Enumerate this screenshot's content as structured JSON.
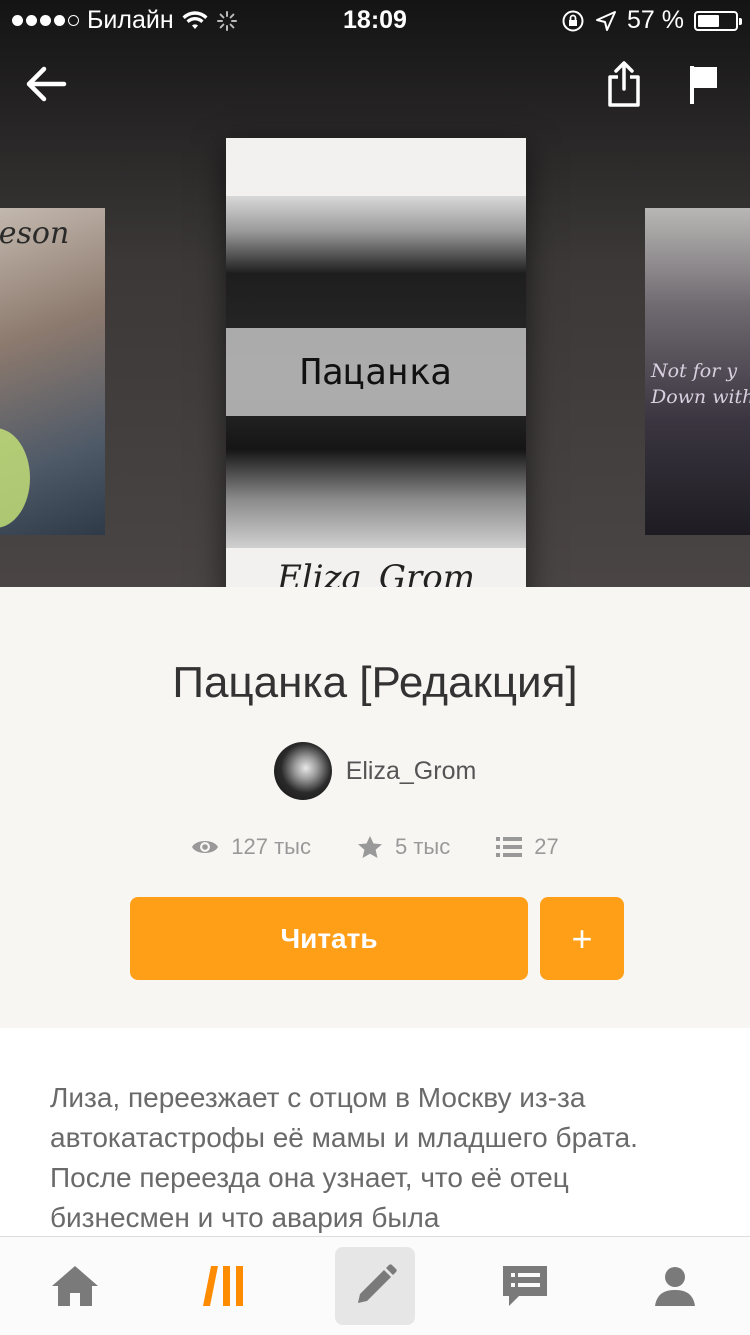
{
  "status_bar": {
    "carrier": "Билайн",
    "time": "18:09",
    "battery_text": "57 %",
    "battery_level": 0.57
  },
  "header": {
    "back_icon": "arrow-left-icon",
    "share_icon": "share-icon",
    "report_icon": "flag-icon"
  },
  "carousel": {
    "left_cover_title": "&Jeson",
    "main_cover": {
      "title": "Пацанка",
      "author": "Eliza_Grom"
    },
    "right_cover_lines": [
      "Not for y",
      "Down with"
    ]
  },
  "story": {
    "title": "Пацанка [Редакция]",
    "author": "Eliza_Grom",
    "stats": {
      "reads": "127 тыс",
      "votes": "5 тыс",
      "parts": "27"
    },
    "read_button": "Читать",
    "add_button": "+",
    "description": "Лиза, переезжает с отцом в Москву из-за автокатастрофы её мамы и младшего брата. После переезда она узнает, что её отец бизнесмен и что авария была"
  },
  "colors": {
    "accent": "#ff9e17",
    "title": "#333333",
    "muted": "#999999"
  },
  "tab_bar": [
    {
      "name": "home",
      "icon": "home-icon"
    },
    {
      "name": "library",
      "icon": "wattpad-logo-icon"
    },
    {
      "name": "write",
      "icon": "pencil-icon"
    },
    {
      "name": "messages",
      "icon": "chat-icon"
    },
    {
      "name": "profile",
      "icon": "user-icon"
    }
  ]
}
